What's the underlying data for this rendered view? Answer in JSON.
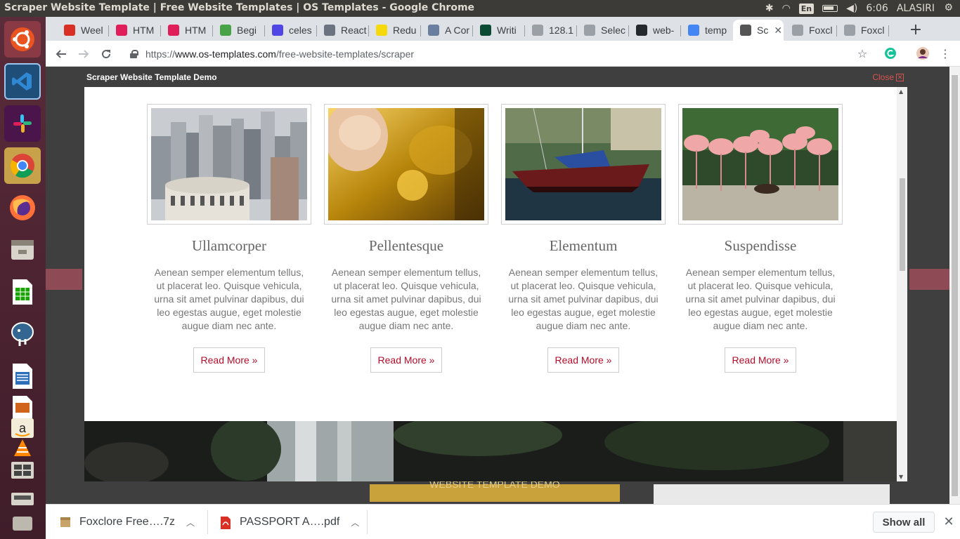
{
  "os": {
    "window_title": "Scraper Website Template | Free Website Templates | OS Templates - Google Chrome",
    "input_lang": "En",
    "clock": "6:06",
    "user": "ALASIRI",
    "tray_icons": [
      "slack-icon",
      "wifi-icon",
      "battery-icon",
      "volume-icon"
    ]
  },
  "launcher": [
    "ubuntu-dash",
    "vscode",
    "slack",
    "chrome",
    "firefox",
    "files",
    "libreoffice-calc",
    "postgres-pgadmin",
    "libreoffice-writer",
    "libreoffice-impress",
    "amazon",
    "vlc",
    "workspaces",
    "scanner"
  ],
  "browser": {
    "tabs": [
      {
        "label": "Weel",
        "icon": "gmail-icon",
        "color": "#d93025"
      },
      {
        "label": "HTM",
        "icon": "play-icon",
        "color": "#e01e5a"
      },
      {
        "label": "HTM",
        "icon": "play-icon",
        "color": "#e01e5a"
      },
      {
        "label": "Begi",
        "icon": "leaf-icon",
        "color": "#47a248"
      },
      {
        "label": "celes",
        "icon": "celes-icon",
        "color": "#4f46e5"
      },
      {
        "label": "React",
        "icon": "react-icon",
        "color": "#6b7280"
      },
      {
        "label": "Redu",
        "icon": "redux-icon",
        "color": "#f5d90a"
      },
      {
        "label": "A Cor",
        "icon": "dc-icon",
        "color": "#6a7f9f"
      },
      {
        "label": "Writi",
        "icon": "django-icon",
        "color": "#0c4b33"
      },
      {
        "label": "128.1",
        "icon": "doc-icon",
        "color": "#9aa0a6"
      },
      {
        "label": "Selec",
        "icon": "doc-icon",
        "color": "#9aa0a6"
      },
      {
        "label": "web-",
        "icon": "github-icon",
        "color": "#24292e"
      },
      {
        "label": "temp",
        "icon": "google-icon",
        "color": "#4285f4"
      },
      {
        "label": "Sc",
        "icon": "ost-icon",
        "color": "#555555",
        "active": true
      },
      {
        "label": "Foxcl",
        "icon": "doc-icon",
        "color": "#9aa0a6"
      },
      {
        "label": "Foxcl",
        "icon": "doc-icon",
        "color": "#9aa0a6"
      }
    ],
    "url": {
      "scheme": "https://",
      "host": "www.os-templates.com",
      "path": "/free-website-templates/scraper"
    }
  },
  "demo": {
    "title": "Scraper Website Template Demo",
    "close_label": "Close"
  },
  "cards": [
    {
      "title": "Ullamcorper",
      "image": "city-skyline-photo",
      "text": "Aenean semper elementum tellus, ut placerat leo. Quisque vehicula, urna sit amet pulvinar dapibus, dui leo egestas augue, eget molestie augue diam nec ante.",
      "link": "Read More »"
    },
    {
      "title": "Pellentesque",
      "image": "saxophone-photo",
      "text": "Aenean semper elementum tellus, ut placerat leo. Quisque vehicula, urna sit amet pulvinar dapibus, dui leo egestas augue, eget molestie augue diam nec ante.",
      "link": "Read More »"
    },
    {
      "title": "Elementum",
      "image": "sailboat-photo",
      "text": "Aenean semper elementum tellus, ut placerat leo. Quisque vehicula, urna sit amet pulvinar dapibus, dui leo egestas augue, eget molestie augue diam nec ante.",
      "link": "Read More »"
    },
    {
      "title": "Suspendisse",
      "image": "flamingos-photo",
      "text": "Aenean semper elementum tellus, ut placerat leo. Quisque vehicula, urna sit amet pulvinar dapibus, dui leo egestas augue, eget molestie augue diam nec ante.",
      "link": "Read More »"
    }
  ],
  "background_page": {
    "button_text": "WEBSITE TEMPLATE DEMO"
  },
  "downloads": {
    "items": [
      {
        "name": "Foxclore Free….7z",
        "icon": "archive-icon"
      },
      {
        "name": "PASSPORT A….pdf",
        "icon": "pdf-icon"
      }
    ],
    "show_all": "Show all"
  },
  "colors": {
    "link": "#b10d2a",
    "close": "#d9534f",
    "launcher": "#5b2c3a"
  }
}
